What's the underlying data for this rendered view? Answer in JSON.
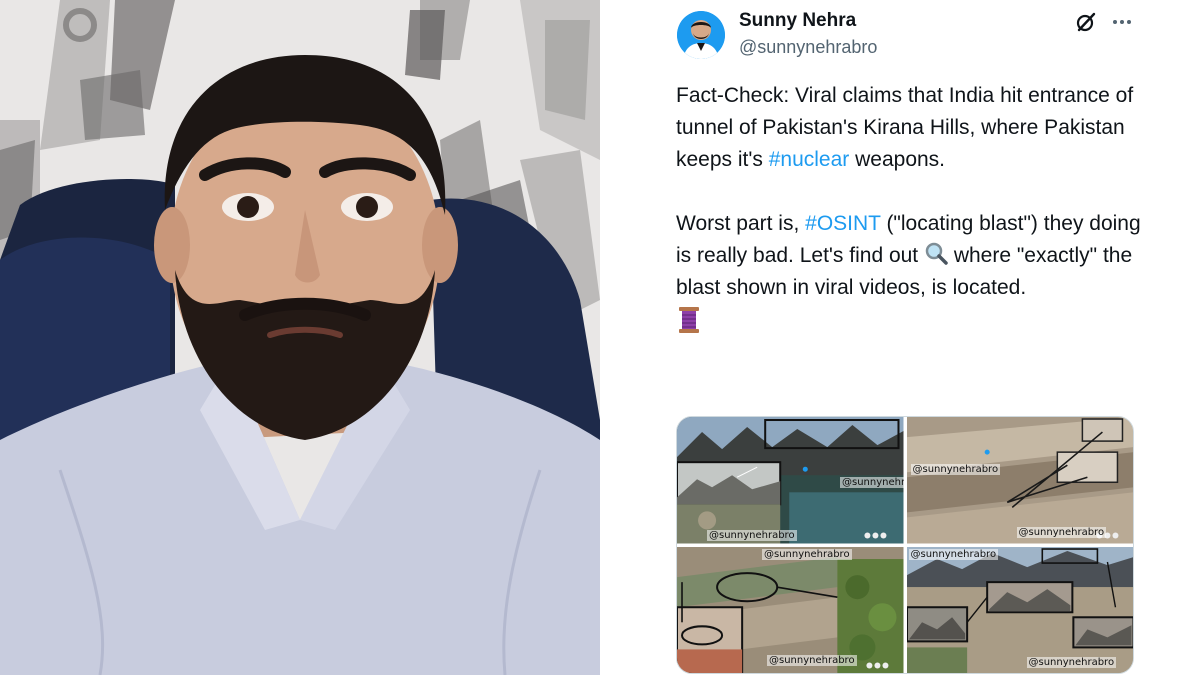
{
  "tweet": {
    "author_name": "Sunny Nehra",
    "author_handle": "@sunnynehrabro",
    "paragraph1": {
      "pre": "Fact-Check: Viral claims that India hit entrance of tunnel of Pakistan's Kirana Hills, where Pakistan keeps it's ",
      "hashtag": "#nuclear",
      "post": " weapons."
    },
    "paragraph2": {
      "pre": "Worst part is, ",
      "hashtag": "#OSINT",
      "mid": " (\"locating blast\") they doing is really bad. Let's find out ",
      "post": " where \"exactly\" the blast shown in viral videos, is located."
    },
    "icons": {
      "grok": "grok-icon",
      "more": "more-icon",
      "magnifier": "magnifier-emoji-icon",
      "thread": "spool-of-thread-icon"
    },
    "media": {
      "watermark": "@sunnynehrabro",
      "watermark_alt": "@sunnynehra"
    }
  },
  "colors": {
    "link": "#1d9bf0",
    "text": "#0f1419",
    "muted": "#536471"
  }
}
